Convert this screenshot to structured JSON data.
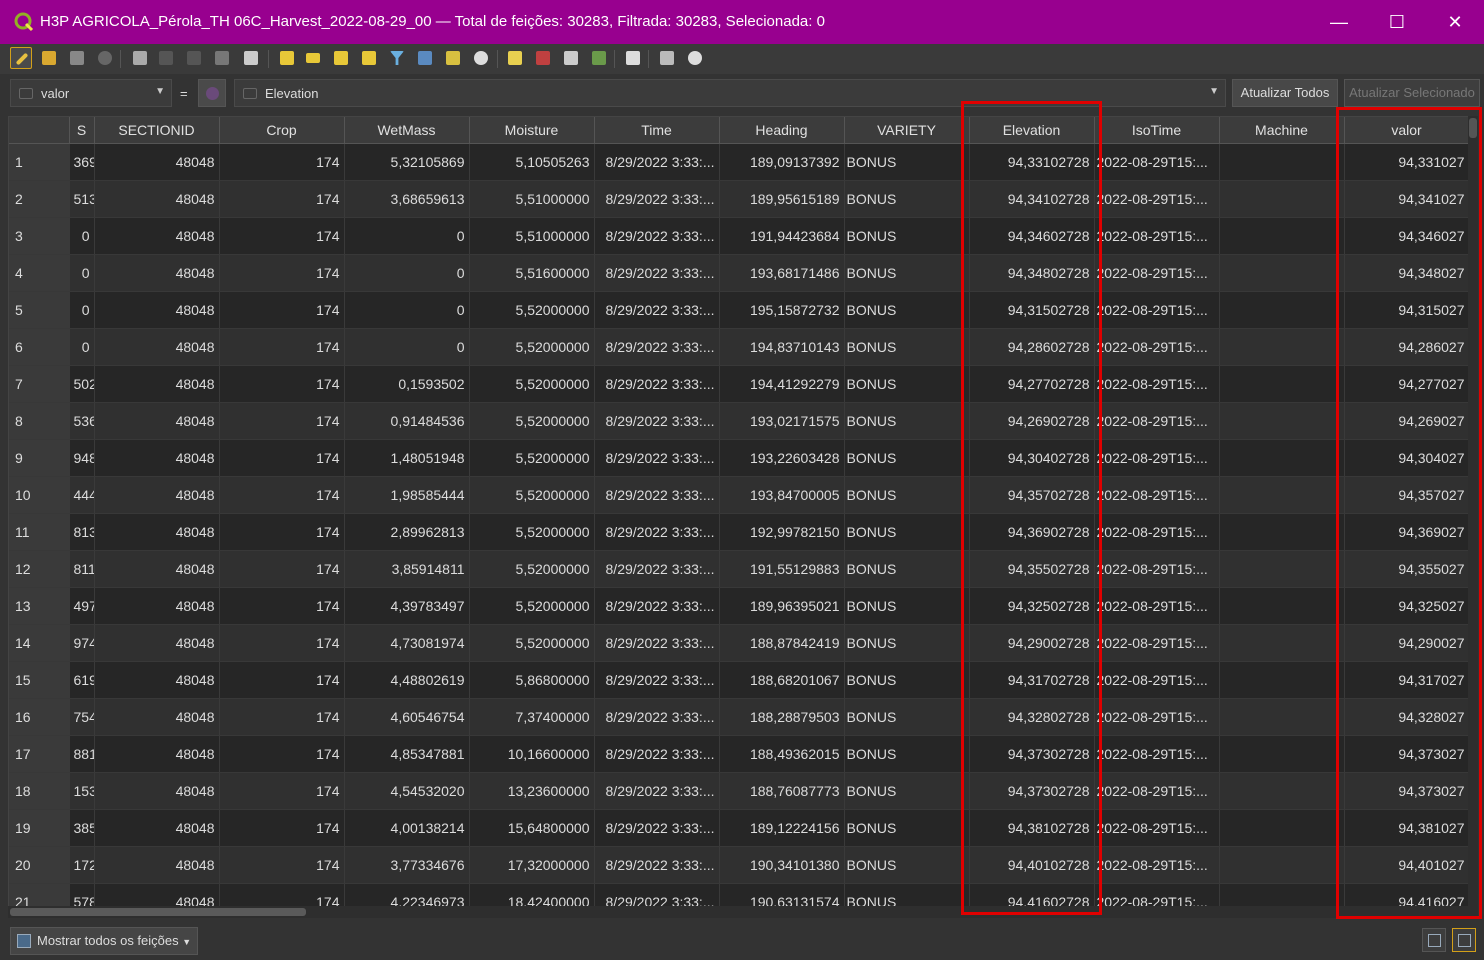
{
  "window": {
    "title": "H3P AGRICOLA_Pérola_TH 06C_Harvest_2022-08-29_00 — Total de feições: 30283, Filtrada: 30283, Selecionada: 0",
    "minimize": "—",
    "maximize": "☐",
    "close": "✕"
  },
  "fieldbar": {
    "field_combo": "valor",
    "equals": "=",
    "expression": "Elevation",
    "update_all": "Atualizar Todos",
    "update_selected": "Atualizar Selecionado"
  },
  "table": {
    "columns": [
      "S",
      "SECTIONID",
      "Crop",
      "WetMass",
      "Moisture",
      "Time",
      "Heading",
      "VARIETY",
      "Elevation",
      "IsoTime",
      "Machine",
      "valor"
    ],
    "rows": [
      [
        "1",
        "369",
        "48048",
        "174",
        "5,32105869",
        "5,10505263",
        "8/29/2022 3:33:...",
        "189,09137392",
        "BONUS",
        "94,33102728",
        "2022-08-29T15:...",
        "",
        "94,331027"
      ],
      [
        "2",
        "513",
        "48048",
        "174",
        "3,68659613",
        "5,51000000",
        "8/29/2022 3:33:...",
        "189,95615189",
        "BONUS",
        "94,34102728",
        "2022-08-29T15:...",
        "",
        "94,341027"
      ],
      [
        "3",
        "0",
        "48048",
        "174",
        "0",
        "5,51000000",
        "8/29/2022 3:33:...",
        "191,94423684",
        "BONUS",
        "94,34602728",
        "2022-08-29T15:...",
        "",
        "94,346027"
      ],
      [
        "4",
        "0",
        "48048",
        "174",
        "0",
        "5,51600000",
        "8/29/2022 3:33:...",
        "193,68171486",
        "BONUS",
        "94,34802728",
        "2022-08-29T15:...",
        "",
        "94,348027"
      ],
      [
        "5",
        "0",
        "48048",
        "174",
        "0",
        "5,52000000",
        "8/29/2022 3:33:...",
        "195,15872732",
        "BONUS",
        "94,31502728",
        "2022-08-29T15:...",
        "",
        "94,315027"
      ],
      [
        "6",
        "0",
        "48048",
        "174",
        "0",
        "5,52000000",
        "8/29/2022 3:33:...",
        "194,83710143",
        "BONUS",
        "94,28602728",
        "2022-08-29T15:...",
        "",
        "94,286027"
      ],
      [
        "7",
        "502",
        "48048",
        "174",
        "0,1593502",
        "5,52000000",
        "8/29/2022 3:33:...",
        "194,41292279",
        "BONUS",
        "94,27702728",
        "2022-08-29T15:...",
        "",
        "94,277027"
      ],
      [
        "8",
        "536",
        "48048",
        "174",
        "0,91484536",
        "5,52000000",
        "8/29/2022 3:33:...",
        "193,02171575",
        "BONUS",
        "94,26902728",
        "2022-08-29T15:...",
        "",
        "94,269027"
      ],
      [
        "9",
        "948",
        "48048",
        "174",
        "1,48051948",
        "5,52000000",
        "8/29/2022 3:33:...",
        "193,22603428",
        "BONUS",
        "94,30402728",
        "2022-08-29T15:...",
        "",
        "94,304027"
      ],
      [
        "10",
        "444",
        "48048",
        "174",
        "1,98585444",
        "5,52000000",
        "8/29/2022 3:33:...",
        "193,84700005",
        "BONUS",
        "94,35702728",
        "2022-08-29T15:...",
        "",
        "94,357027"
      ],
      [
        "11",
        "813",
        "48048",
        "174",
        "2,89962813",
        "5,52000000",
        "8/29/2022 3:33:...",
        "192,99782150",
        "BONUS",
        "94,36902728",
        "2022-08-29T15:...",
        "",
        "94,369027"
      ],
      [
        "12",
        "811",
        "48048",
        "174",
        "3,85914811",
        "5,52000000",
        "8/29/2022 3:33:...",
        "191,55129883",
        "BONUS",
        "94,35502728",
        "2022-08-29T15:...",
        "",
        "94,355027"
      ],
      [
        "13",
        "497",
        "48048",
        "174",
        "4,39783497",
        "5,52000000",
        "8/29/2022 3:33:...",
        "189,96395021",
        "BONUS",
        "94,32502728",
        "2022-08-29T15:...",
        "",
        "94,325027"
      ],
      [
        "14",
        "974",
        "48048",
        "174",
        "4,73081974",
        "5,52000000",
        "8/29/2022 3:33:...",
        "188,87842419",
        "BONUS",
        "94,29002728",
        "2022-08-29T15:...",
        "",
        "94,290027"
      ],
      [
        "15",
        "619",
        "48048",
        "174",
        "4,48802619",
        "5,86800000",
        "8/29/2022 3:33:...",
        "188,68201067",
        "BONUS",
        "94,31702728",
        "2022-08-29T15:...",
        "",
        "94,317027"
      ],
      [
        "16",
        "754",
        "48048",
        "174",
        "4,60546754",
        "7,37400000",
        "8/29/2022 3:33:...",
        "188,28879503",
        "BONUS",
        "94,32802728",
        "2022-08-29T15:...",
        "",
        "94,328027"
      ],
      [
        "17",
        "881",
        "48048",
        "174",
        "4,85347881",
        "10,16600000",
        "8/29/2022 3:33:...",
        "188,49362015",
        "BONUS",
        "94,37302728",
        "2022-08-29T15:...",
        "",
        "94,373027"
      ],
      [
        "18",
        "153",
        "48048",
        "174",
        "4,54532020",
        "13,23600000",
        "8/29/2022 3:33:...",
        "188,76087773",
        "BONUS",
        "94,37302728",
        "2022-08-29T15:...",
        "",
        "94,373027"
      ],
      [
        "19",
        "385",
        "48048",
        "174",
        "4,00138214",
        "15,64800000",
        "8/29/2022 3:33:...",
        "189,12224156",
        "BONUS",
        "94,38102728",
        "2022-08-29T15:...",
        "",
        "94,381027"
      ],
      [
        "20",
        "172",
        "48048",
        "174",
        "3,77334676",
        "17,32000000",
        "8/29/2022 3:33:...",
        "190,34101380",
        "BONUS",
        "94,40102728",
        "2022-08-29T15:...",
        "",
        "94,401027"
      ],
      [
        "21",
        "578",
        "48048",
        "174",
        "4,22346973",
        "18,42400000",
        "8/29/2022 3:33:...",
        "190,63131574",
        "BONUS",
        "94,41602728",
        "2022-08-29T15:...",
        "",
        "94,416027"
      ]
    ]
  },
  "bottombar": {
    "show_all": "Mostrar todos os feições"
  },
  "colors": {
    "titlebar": "#98008f",
    "highlight": "#e00000",
    "active_tool": "#d3a019"
  }
}
